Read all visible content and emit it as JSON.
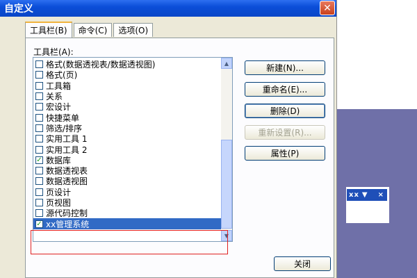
{
  "window": {
    "title": "自定义",
    "close_glyph": "✕"
  },
  "tabs": [
    {
      "label": "工具栏(B)",
      "active": true
    },
    {
      "label": "命令(C)",
      "active": false
    },
    {
      "label": "选项(O)",
      "active": false
    }
  ],
  "toolbars_label": "工具栏(A):",
  "toolbar_items": [
    {
      "label": "格式(数据透视表/数据透视图)",
      "checked": false
    },
    {
      "label": "格式(页)",
      "checked": false
    },
    {
      "label": "工具箱",
      "checked": false
    },
    {
      "label": "关系",
      "checked": false
    },
    {
      "label": "宏设计",
      "checked": false
    },
    {
      "label": "快捷菜单",
      "checked": false
    },
    {
      "label": "筛选/排序",
      "checked": false
    },
    {
      "label": "实用工具 1",
      "checked": false
    },
    {
      "label": "实用工具 2",
      "checked": false
    },
    {
      "label": "数据库",
      "checked": true
    },
    {
      "label": "数据透视表",
      "checked": false
    },
    {
      "label": "数据透视图",
      "checked": false
    },
    {
      "label": "页设计",
      "checked": false
    },
    {
      "label": "页视图",
      "checked": false
    },
    {
      "label": "源代码控制",
      "checked": false
    },
    {
      "label": "xx管理系统",
      "checked": true,
      "selected": true
    }
  ],
  "buttons": {
    "new": "新建(N)...",
    "rename": "重命名(E)...",
    "delete": "删除(D)",
    "reset": "重新设置(R)...",
    "properties": "属性(P)",
    "close": "关闭"
  },
  "floating_toolbar": {
    "title": "xx",
    "arrow": "▼",
    "close": "×"
  },
  "colors": {
    "selection": "#316ac5",
    "title_bar": "#0b4ed8",
    "annotation_box": "#e02020"
  }
}
